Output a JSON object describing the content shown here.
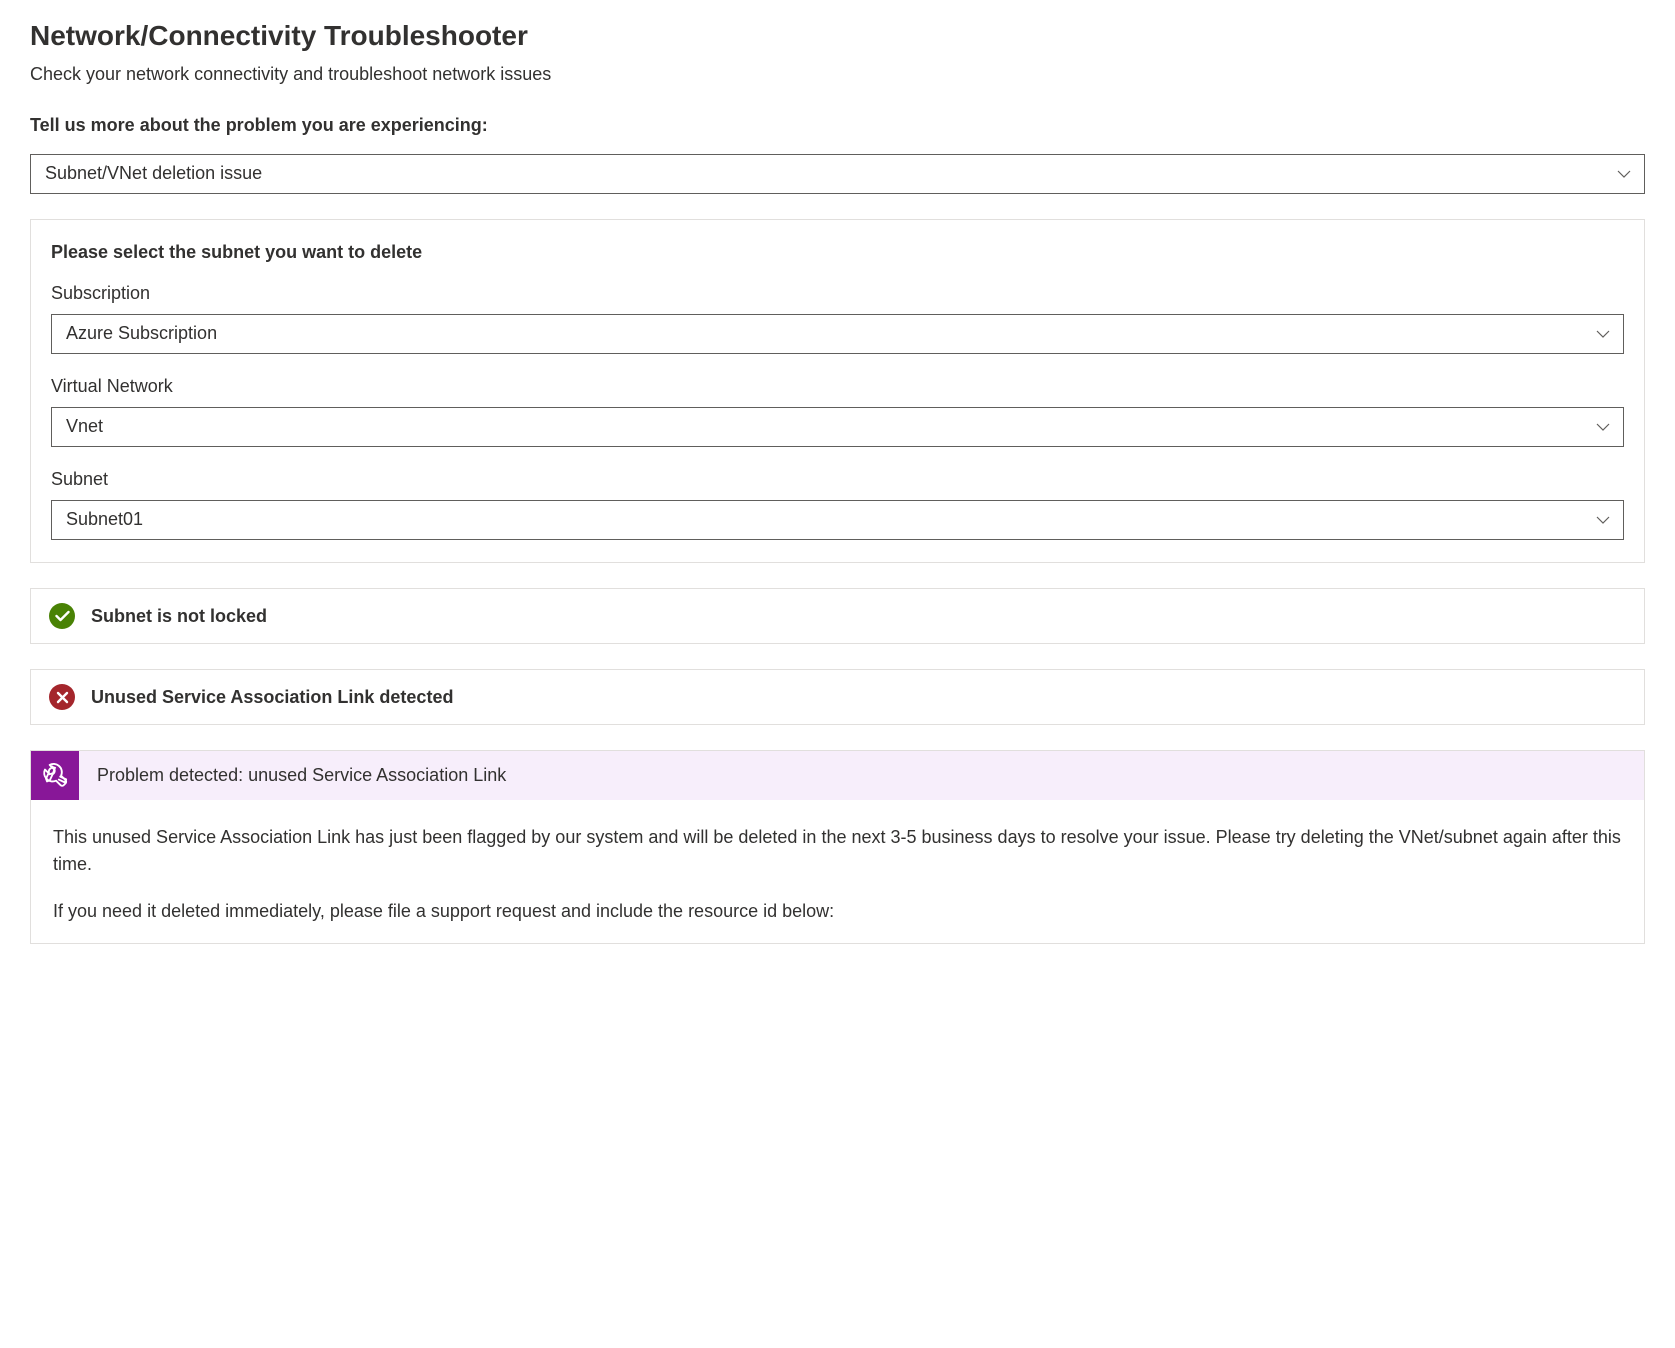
{
  "header": {
    "title": "Network/Connectivity Troubleshooter",
    "subtitle": "Check your network connectivity and troubleshoot network issues"
  },
  "problemSelector": {
    "label": "Tell us more about the problem you are experiencing:",
    "value": "Subnet/VNet deletion issue"
  },
  "subnetPanel": {
    "title": "Please select the subnet you want to delete",
    "fields": {
      "subscription": {
        "label": "Subscription",
        "value": "Azure Subscription"
      },
      "virtualNetwork": {
        "label": "Virtual Network",
        "value": "Vnet"
      },
      "subnet": {
        "label": "Subnet",
        "value": "Subnet01"
      }
    }
  },
  "statusChecks": {
    "locked": {
      "text": "Subnet is not locked",
      "state": "success"
    },
    "sal": {
      "text": "Unused Service Association Link detected",
      "state": "error"
    }
  },
  "problemDetail": {
    "headerText": "Problem detected: unused Service Association Link",
    "paragraph1": "This unused Service Association Link has just been flagged by our system and will be deleted in the next 3-5 business days to resolve your issue. Please try deleting the VNet/subnet again after this time.",
    "paragraph2": "If you need it deleted immediately, please file a support request and include the resource id below:"
  }
}
